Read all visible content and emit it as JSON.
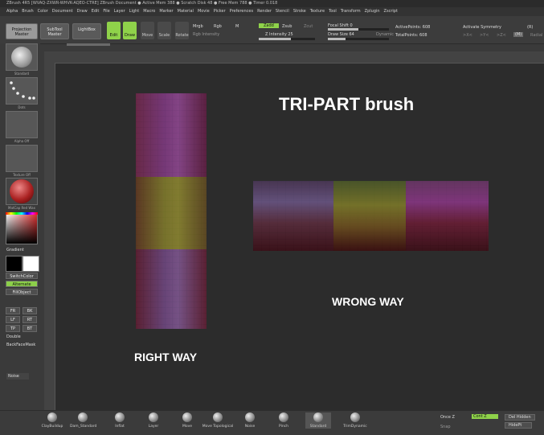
{
  "titlebar": "ZBrush 4R5 [WVAQ-ZXWR-WHVK-AQEO-CTRE]    ZBrush Document    ● Active Mem 388 ● Scratch Disk 48 ● Free Mem 788 ● Timer 0.018",
  "menu": [
    "Alpha",
    "Brush",
    "Color",
    "Document",
    "Draw",
    "Edit",
    "File",
    "Layer",
    "Light",
    "Macro",
    "Marker",
    "Material",
    "Movie",
    "Picker",
    "Preferences",
    "Render",
    "Stencil",
    "Stroke",
    "Texture",
    "Tool",
    "Transform",
    "Zplugin",
    "Zscript"
  ],
  "toolbar": {
    "projection_master": "Projection Master",
    "subtool_master": "SubTool Master",
    "lightbox": "LightBox",
    "edit": "Edit",
    "draw": "Draw",
    "move": "Move",
    "scale": "Scale",
    "rotate": "Rotate",
    "mrgb": "Mrgb",
    "rgb": "Rgb",
    "m": "M",
    "rgb_intensity": "Rgb Intensity",
    "zadd": "Zadd",
    "zsub": "Zsub",
    "zcut": "Zcut",
    "z_intensity": "Z Intensity 25",
    "focal_shift": "Focal Shift 0",
    "draw_size": "Draw Size 64",
    "dynamic": "Dynamic",
    "active_points": "ActivePoints: 608",
    "total_points": "TotalPoints: 608",
    "activate_symmetry": "Activate Symmetry",
    "sym_r": "(R)",
    "sym_x": ">X<",
    "sym_y": ">Y<",
    "sym_z": ">Z<",
    "sym_m": "(M)",
    "radial": "Radial"
  },
  "left": {
    "standard": "Standard",
    "dots": "Dots",
    "alpha_off": "Alpha Off",
    "texture_off": "Texture Off",
    "matcap": "MatCap Red Wax",
    "gradient": "Gradient",
    "switchcolor": "SwitchColor",
    "alternate": "Alternate",
    "fillobject": "FillObject",
    "fr": "FR",
    "bk": "BK",
    "lf": "LF",
    "rt": "RT",
    "tp": "TP",
    "bt": "BT",
    "double": "Double",
    "backfacemask": "BackFaceMask",
    "noise": "Noise"
  },
  "canvas": {
    "title": "TRI-PART brush",
    "right_way": "RIGHT WAY",
    "wrong_way": "WRONG WAY"
  },
  "bottom": {
    "brushes": [
      "ClayBuildup",
      "Dam_Standard",
      "Inflat",
      "Layer",
      "Move",
      "Move Topological",
      "Noise",
      "Pinch",
      "Standard",
      "TrimDynamic"
    ],
    "once_z": "Once Z",
    "snap": "Snap",
    "cont_z": "Cont Z",
    "del_hidden": "Del Hidden",
    "hidept": "HidePt"
  },
  "colors": {
    "accent_green": "#8fd24a",
    "purple": "#7a3a7a",
    "olive": "#7a7a2a",
    "maroon": "#5a1e2a"
  }
}
